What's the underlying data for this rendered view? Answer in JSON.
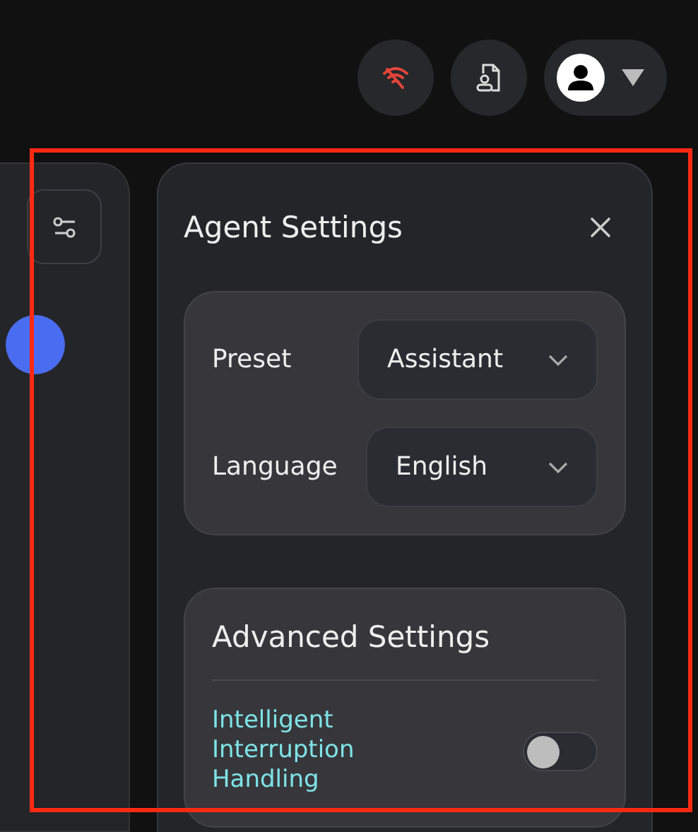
{
  "panel": {
    "title": "Agent Settings"
  },
  "fields": [
    {
      "label": "Preset",
      "value": "Assistant"
    },
    {
      "label": "Language",
      "value": "English"
    }
  ],
  "advanced": {
    "title": "Advanced Settings",
    "toggles": [
      {
        "label": "Intelligent Interruption Handling",
        "on": false
      }
    ]
  }
}
